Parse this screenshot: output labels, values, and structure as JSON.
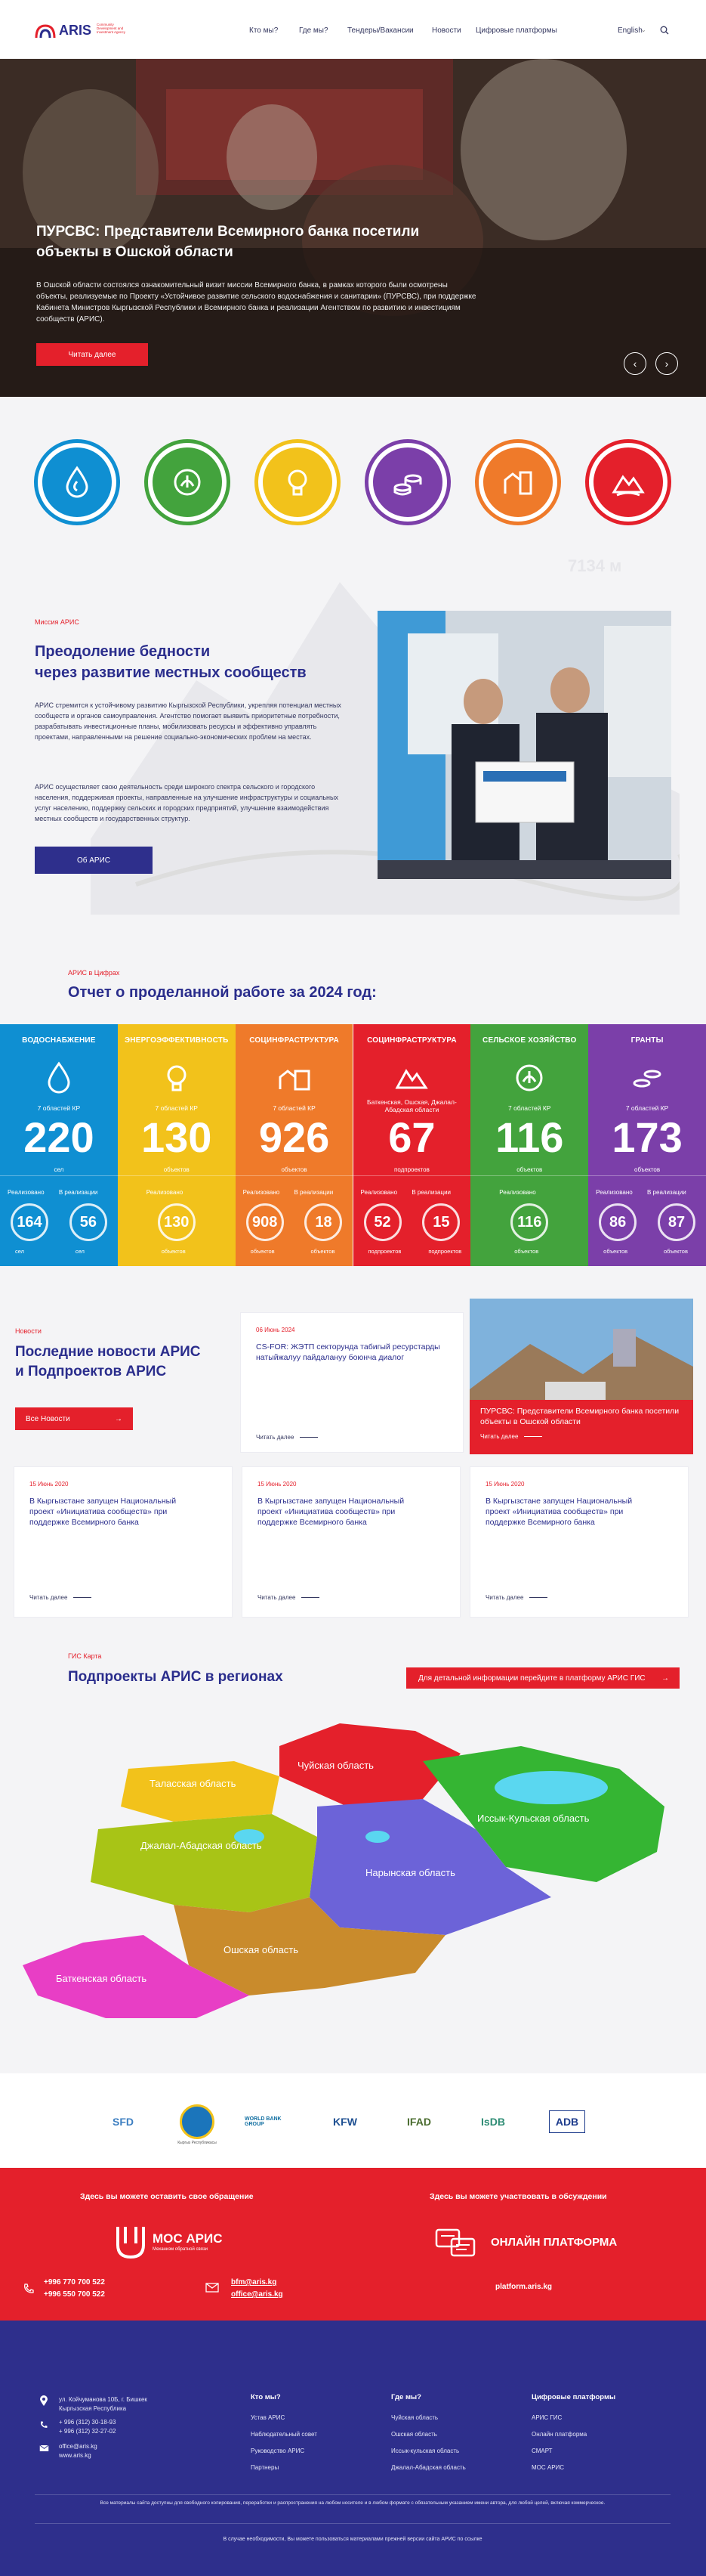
{
  "header": {
    "logo_text": "ARIS",
    "logo_sub": "Community Development and Investment Agency",
    "nav": [
      "Кто мы?",
      "Где мы?",
      "Тендеры/Вакансии",
      "Новости",
      "Цифровые платформы"
    ],
    "lang": "English"
  },
  "hero": {
    "title": "ПУРСВС: Представители Всемирного банка посетили объекты в Ошской области",
    "text": "В Ошской области состоялся ознакомительный визит миссии Всемирного банка, в рамках которого были осмотрены объекты, реализуемые по Проекту «Устойчивое развитие сельского водоснабжения и санитарии» (ПУРСВС), при поддержке Кабинета Министров Кыргызской Республики и Всемирного банка и реализации Агентством по развитию и инвестициям сообществ (АРИС).",
    "button": "Читать далее"
  },
  "icons": [
    {
      "name": "water-icon",
      "color": "#0f8fd2"
    },
    {
      "name": "agriculture-icon",
      "color": "#43a33d"
    },
    {
      "name": "energy-icon",
      "color": "#f2c21b"
    },
    {
      "name": "grants-icon",
      "color": "#7b3fa9"
    },
    {
      "name": "infrastructure-icon",
      "color": "#ef7a2a"
    },
    {
      "name": "social-icon",
      "color": "#e4202b"
    }
  ],
  "mission": {
    "tag": "Миссия АРИС",
    "title_line1": "Преодоление бедности",
    "title_line2": "через развитие местных сообществ",
    "p1": "АРИС стремится к устойчивому развитию Кыргызской Республики, укрепляя потенциал местных сообществ и органов самоуправления. Агентство помогает выявить приоритетные потребности, разрабатывать инвестиционные планы, мобилизовать ресурсы и эффективно управлять проектами, направленными на решение социально-экономических проблем на местах.",
    "p2": "АРИС осуществляет свою деятельность среди широкого спектра сельского и городского населения, поддерживая проекты, направленные на улучшение инфраструктуры и социальных услуг населению, поддержку сельских и городских предприятий, улучшение взаимодействия местных сообществ и государственных структур.",
    "button": "Об АРИС",
    "watermark": "7134 м"
  },
  "report": {
    "tag": "АРИС в Цифрах",
    "title": "Отчет о проделанной работе за 2024 год:",
    "columns": [
      {
        "title": "ВОДОСНАБЖЕНИЕ",
        "icon": "water-drop-icon",
        "sub": "7 областей КР",
        "value": "220",
        "unit": "сел",
        "lbl1": "Реализовано",
        "lbl2": "В реализации",
        "r1": "164",
        "r2": "56",
        "u1": "сел",
        "u2": "сел",
        "color": "#0f8fd2"
      },
      {
        "title": "ЭНЕРГОЭФФЕКТИВНОСТЬ",
        "icon": "lightbulb-icon",
        "sub": "7 областей КР",
        "value": "130",
        "unit": "объектов",
        "lbl1": "Реализовано",
        "lbl2": "",
        "r1": "130",
        "r2": "",
        "u1": "объектов",
        "u2": "",
        "color": "#f2c21b"
      },
      {
        "title": "СОЦИНФРАСТРУКТУРА",
        "icon": "buildings-icon",
        "sub": "7 областей КР",
        "value": "926",
        "unit": "объектов",
        "lbl1": "Реализовано",
        "lbl2": "В реализации",
        "r1": "908",
        "r2": "18",
        "u1": "объектов",
        "u2": "объектов",
        "color": "#ef7a2a"
      },
      {
        "title": "СОЦИНФРАСТРУКТУРА",
        "icon": "mountain-icon",
        "sub": "Баткенская, Ошская, Джалал-Абадская области",
        "value": "67",
        "unit": "подпроектов",
        "lbl1": "Реализовано",
        "lbl2": "В реализации",
        "r1": "52",
        "r2": "15",
        "u1": "подпроектов",
        "u2": "подпроектов",
        "color": "#e4202b"
      },
      {
        "title": "СЕЛЬСКОЕ ХОЗЯЙСТВО",
        "icon": "agriculture-icon",
        "sub": "7 областей КР",
        "value": "116",
        "unit": "объектов",
        "lbl1": "Реализовано",
        "lbl2": "",
        "r1": "116",
        "r2": "",
        "u1": "объектов",
        "u2": "",
        "color": "#43a33d"
      },
      {
        "title": "ГРАНТЫ",
        "icon": "coins-icon",
        "sub": "7 областей КР",
        "value": "173",
        "unit": "объектов",
        "lbl1": "Реализовано",
        "lbl2": "В реализации",
        "r1": "86",
        "r2": "87",
        "u1": "объектов",
        "u2": "объектов",
        "color": "#7b3fa9"
      }
    ]
  },
  "news": {
    "tag": "Новости",
    "title_line1": "Последние новости АРИС",
    "title_line2": "и Подпроектов АРИС",
    "button": "Все Новости",
    "read_more": "Читать далее",
    "featured": {
      "date": "06 Июнь 2024",
      "text": "CS-FOR: ЖЭТП секторунда табигый ресурстарды натыйжалуу пайдалануу боюнча диалог"
    },
    "photo_card": {
      "text": "ПУРСВС: Представители Всемирного банка посетили объекты в Ошской области"
    },
    "cards": [
      {
        "date": "15 Июнь 2020",
        "text": "В Кыргызстане запущен Национальный проект «Инициатива сообществ» при поддержке Всемирного банка"
      },
      {
        "date": "15 Июнь 2020",
        "text": "В Кыргызстане запущен Национальный проект «Инициатива сообществ» при поддержке Всемирного банка"
      },
      {
        "date": "15 Июнь 2020",
        "text": "В Кыргызстане запущен Национальный проект «Инициатива сообществ» при поддержке Всемирного банка"
      }
    ]
  },
  "gis": {
    "tag": "ГИС Карта",
    "title": "Подпроекты АРИС в регионах",
    "button": "Для детальной информации перейдите в платформу АРИС ГИС",
    "regions": [
      {
        "name": "Таласская область",
        "color": "#f2c21b"
      },
      {
        "name": "Чуйская область",
        "color": "#e4202b"
      },
      {
        "name": "Иссык-Кульская область",
        "color": "#35b533"
      },
      {
        "name": "Джалал-Абадская область",
        "color": "#a8c416"
      },
      {
        "name": "Нарынская область",
        "color": "#6c63d8"
      },
      {
        "name": "Ошская область",
        "color": "#c98b2c"
      },
      {
        "name": "Баткенская область",
        "color": "#e83ec5"
      }
    ]
  },
  "partners": [
    "SFD",
    "Кыргыз Республикасы",
    "WORLD BANK GROUP",
    "KFW",
    "IFAD",
    "IsDB",
    "ADB"
  ],
  "appeal": {
    "left_title": "Здесь вы можете оставить свое обращение",
    "left_brand": "МОС АРИС",
    "left_brand_sub": "Механизм обратной связи",
    "phone1": "+996 770 700 522",
    "phone2": "+996 550 700 522",
    "email1": "bfm@aris.kg",
    "email2": "office@aris.kg",
    "right_title": "Здесь вы можете участвовать в обсуждении",
    "right_brand": "ОНЛАЙН ПЛАТФОРМА",
    "right_link": "platform.aris.kg"
  },
  "footer": {
    "address1": "ул. Койчуманова 10Б, г. Бишкек",
    "address2": "Кыргызская Республика",
    "phone1": "+ 996 (312) 30-18-93",
    "phone2": "+ 996 (312) 32-27-02",
    "email": "office@aris.kg",
    "site": "www.aris.kg",
    "cols": [
      {
        "title": "Кто мы?",
        "items": [
          "Устав АРИС",
          "Наблюдательный совет",
          "Руководство АРИС",
          "Партнеры"
        ]
      },
      {
        "title": "Где мы?",
        "items": [
          "Чуйская область",
          "Ошская область",
          "Иссык-кульская область",
          "Джалал-Абадская область"
        ]
      },
      {
        "title": "Цифровые платформы",
        "items": [
          "АРИС ГИС",
          "Онлайн платформа",
          "СМАРТ",
          "МОС АРИС"
        ]
      }
    ],
    "note": "Все материалы сайта доступны для свободного копирования, переработки и распространения на любом носителе и в любом формате с обязательным указанием имени автора, для любой целей, включая коммерческое.",
    "bottom": "В случае необходимости, Вы можете пользоваться материалами прежней версии сайта АРИС по ссылке"
  }
}
